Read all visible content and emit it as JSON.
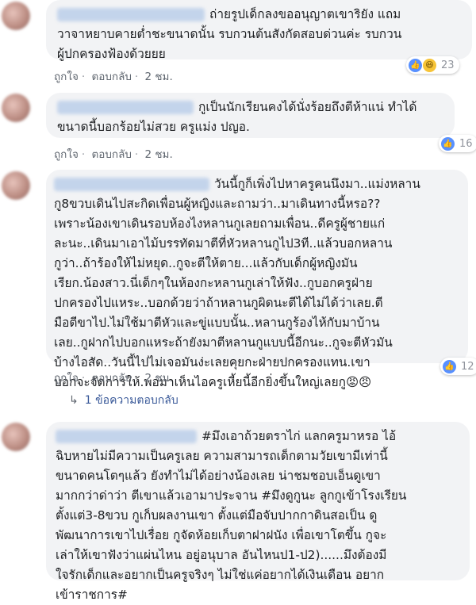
{
  "comments": [
    {
      "lines": [
        "ถ่ายรูปเด็กลงขออนุญาตเขาริยัง แถม",
        "วาจาหยาบคายต่ำชะขนาดนั้น รบกวนต้นสังกัดสอบด่วนค่ะ รบกวน",
        "ผู้ปกครองฟ้องด้วยยย"
      ],
      "reactions": [
        "like-icon",
        "haha-icon"
      ],
      "reaction_count": "23",
      "like_label": "ถูกใจ",
      "reply_label": "ตอบกลับ",
      "time": "2 ชม."
    },
    {
      "lines": [
        "กูเป็นนักเรียนคงได้นั่งร้อยถึงตีห้าแน่ ทำได้",
        "ขนาดนี้บอกร้อยไม่สวย ครูแม่ง ปญอ."
      ],
      "reactions": [
        "like-icon"
      ],
      "reaction_count": "16",
      "like_label": "ถูกใจ",
      "reply_label": "ตอบกลับ",
      "time": "2 ชม."
    },
    {
      "lines": [
        "วันนี้กูก็เพิ่งไปหาครูคนนึงมา..แม่งหลาน",
        "กู8ขวบเดินไปสะกิดเพื่อนผู้หญิงและถามว่า..มาเดินทางนี้หรอ??",
        "เพราะน้องเขาเดินรอบห้องไงหลานกูเลยถามเพื่อน..ดีครูผู้ชายแก่",
        "ละนะ..เดินมาเอาไม้บรรทัดมาตีที่หัวหลานกูไป3ที..แล้วบอกหลาน",
        "กูว่า..ถ้าร้องให้ไม่หยุด..กูจะตีให้ตาย...แล้วกับเด็กผู้หญิงมัน",
        "เรียก.น้องสาว.นี่เด็กๆในห้องกะหลานกูเล่าให้ฟัง..กูบอกครูฝ่าย",
        "ปกครองไปแหระ..บอกด้วยว่าถ้าหลานกูผิดนะตีได้ไม่ได้ว่าเลย.ตี",
        "มือตีขาไป.ไม่ใช้มาตีหัวและขู่แบบนั้น..หลานกูร้องไห้กับมาบ้าน",
        "เลย..กูฝากไปบอกแหระถ้ายังมาตีหลานกูแบบนี้อีกนะ..กูจะตีหัวมัน",
        "บ้างไอสัด..วันนี้ไปไม่เจอมันง่ะเลยคุยกะฝ่ายปกครองแทน.เขา",
        "บอกจะจัดการให้.พอมาเห็นไอครูเหี้ยนี้อีกยิ่งขึ้นใหญ่เลยกู😡😠"
      ],
      "reactions": [
        "like-icon"
      ],
      "reaction_count": "12",
      "like_label": "ถูกใจ",
      "reply_label": "ตอบกลับ",
      "time": "2 ชม."
    },
    {
      "lines": [
        "#มึงเอาถ้วยตราไก่ แลกครูมาหรอ ไอ้",
        "ฉิบหายไม่มีความเป็นครูเลย ความสามารถเด็กตามวัยเขามีเท่านี้",
        "ขนาดคนโตๆแล้ว ยังทำไม่ได้อย่างน้องเลย น่าชมชอบเอ็นดูเขา",
        "มากกว่าด่าว่า ตีเขาแล้วเอามาประจาน #มึงดูกูนะ ลูกกูเข้าโรงเรียน",
        "ตั้งแต่3-8ขวบ กูเก็บผลงานเขา ตั้งแต่มือจับปากกาดินสอเป็น ดู",
        "พัฒนาการเขาไปเรื่อย กูจัดห้อยเก็บตาฝาฝนัง เพื่อเขาโตขึ้น กูจะ",
        "เล่าให้เขาฟังว่าแผ่นไหน อยู่อนุบาล อันไหนป1-ป2)......มึงต้องมี",
        "ใจรักเด็กและอยากเป็นครูจริงๆ ไม่ใช่แค่อยากได้เงินเดือน อยาก",
        "เข้าราชการ#"
      ]
    }
  ],
  "replies_link": "1 ข้อความตอบกลับ",
  "colors": {
    "bubble": "#f2f3f5",
    "link": "#385898",
    "like": "#5890ff"
  }
}
